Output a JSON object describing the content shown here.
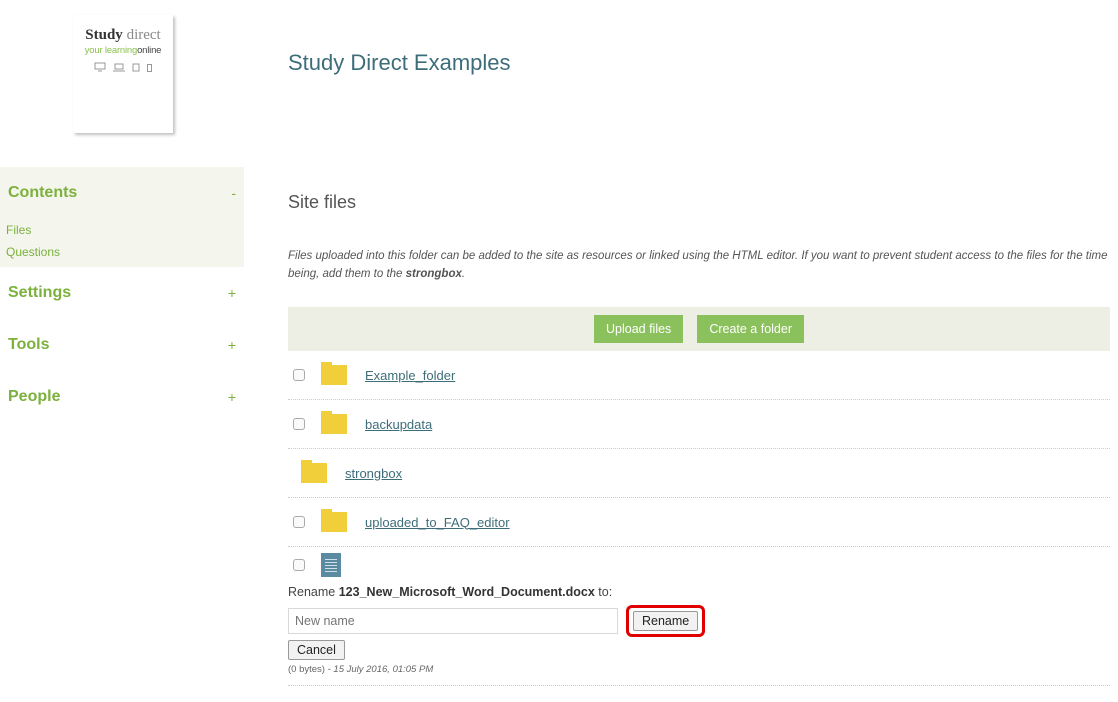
{
  "logo": {
    "title_bold": "Study",
    "title_light": "direct",
    "tag_green": "your learning",
    "tag_dark": "online",
    "device_icons": [
      "desktop-icon",
      "laptop-icon",
      "tablet-icon",
      "phone-icon"
    ]
  },
  "site_title": "Study Direct Examples",
  "sidebar": {
    "sections": [
      {
        "label": "Contents",
        "toggle": "-",
        "links": [
          "Files",
          "Questions"
        ]
      },
      {
        "label": "Settings",
        "toggle": "+"
      },
      {
        "label": "Tools",
        "toggle": "+"
      },
      {
        "label": "People",
        "toggle": "+"
      }
    ]
  },
  "main": {
    "section_title": "Site files",
    "description_pre": "Files uploaded into this folder can be added to the site as resources or linked using the HTML editor. If you want to prevent student access to the files for the time being, add them to the ",
    "description_bold": "strongbox",
    "description_post": ".",
    "upload_label": "Upload files",
    "create_folder_label": "Create a folder",
    "folders": [
      "Example_folder",
      "backupdata",
      "strongbox",
      "uploaded_to_FAQ_editor"
    ],
    "rename": {
      "prefix": "Rename ",
      "filename": "123_New_Microsoft_Word_Document.docx",
      "suffix": " to:",
      "placeholder": "New name",
      "rename_button": "Rename",
      "cancel_button": "Cancel",
      "size": "(0 bytes)",
      "date": " - 15 July 2016, 01:05 PM"
    }
  },
  "colors": {
    "accent_green": "#8bc15c",
    "title_teal": "#3e6d7a",
    "highlight_red": "#e00000",
    "folder_yellow": "#f0cf3a"
  }
}
